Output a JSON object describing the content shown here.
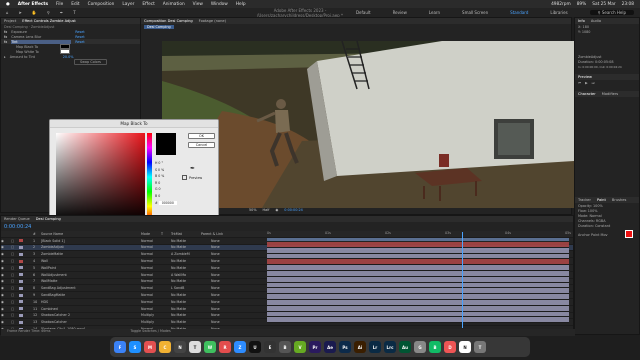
{
  "mac_menu": {
    "app": "After Effects",
    "items": [
      "File",
      "Edit",
      "Composition",
      "Layer",
      "Effect",
      "Animation",
      "View",
      "Window",
      "Help"
    ],
    "status": [
      "4982rpm",
      "89%",
      "Sat 25 Mar",
      "23:08"
    ]
  },
  "title": "Adobe After Effects 2023 - /Users/zacharychildress/Desktop/Proj.aep *",
  "toolbar": {
    "workspaces": [
      "Default",
      "Review",
      "Learn",
      "Small Screen",
      "Standard",
      "Libraries"
    ],
    "active": "Standard",
    "search": "Search Help"
  },
  "effect_controls": {
    "tabs": [
      "Project",
      "Effect Controls Zombie Adjust"
    ],
    "header": "Desi Comping · ZombieAdjust",
    "rows": [
      {
        "name": "Exposure",
        "value": "Reset"
      },
      {
        "name": "Camera Lens Blur",
        "value": "Reset"
      },
      {
        "name": "Tint",
        "value": "Reset"
      },
      {
        "name": "Map Black To",
        "value": ""
      },
      {
        "name": "Map White To",
        "value": ""
      },
      {
        "name": "Amount to Tint",
        "value": "20.0%"
      }
    ],
    "swap_button": "Swap Colors"
  },
  "comp": {
    "tabs": [
      "Composition Desi Comping",
      "Footage (none)"
    ],
    "breadcrumb": "Desi Comping",
    "zoom": "50%",
    "quality": "Half",
    "timecode": "0:00:00:24"
  },
  "dialog": {
    "title": "Map Black To",
    "ok": "OK",
    "cancel": "Cancel",
    "preview": "Preview",
    "fields": [
      {
        "label": "H",
        "value": "0 °"
      },
      {
        "label": "S",
        "value": "0 %"
      },
      {
        "label": "B",
        "value": "0 %"
      },
      {
        "label": "R",
        "value": "0"
      },
      {
        "label": "G",
        "value": "0"
      },
      {
        "label": "B",
        "value": "0"
      }
    ],
    "hex_label": "#",
    "hex": "000000"
  },
  "right_panels": {
    "info": {
      "tabs": [
        "Info",
        "Audio"
      ],
      "x": "X: 180",
      "y": "Y: 1080"
    },
    "name": "ZombieAdjust",
    "duration": "Duration: 0:00:05:08",
    "in_out": "In: 0:00:00:00, Out: 0:00:04:24",
    "preview": "Preview",
    "character_tabs": [
      "Character",
      "Modifiers"
    ],
    "tracker_tabs": [
      "Tracker",
      "Paint",
      "Brushes"
    ],
    "paint": {
      "opacity": "Opacity: 100%",
      "flow": "Flow: 100%",
      "mode": "Mode: Normal",
      "channels": "Channels: RGBA",
      "duration": "Duration: Constant"
    },
    "anchor": "Anchor Point Mov"
  },
  "timeline": {
    "tab": "Desi Comping",
    "render_q": "Render Queue",
    "timecode": "0:00:00:24",
    "columns": [
      "#",
      "Source Name",
      "Mode",
      "T",
      "TrkMat",
      "",
      "Parent & Link"
    ],
    "rulers": [
      "0s",
      "01s",
      "02s",
      "03s",
      "04s",
      "05s"
    ],
    "layers": [
      {
        "n": "1",
        "name": "[Black Solid 1]",
        "mode": "Normal",
        "trk": "No Matte",
        "parent": "None",
        "color": "#b04848"
      },
      {
        "n": "2",
        "name": "ZombieAdjust",
        "mode": "Normal",
        "trk": "No Matte",
        "parent": "None",
        "color": "#9a9ab8"
      },
      {
        "n": "3",
        "name": "ZombieMatte",
        "mode": "Normal",
        "trk": "A ZombieM",
        "parent": "None",
        "color": "#9a9ab8"
      },
      {
        "n": "4",
        "name": "Wall",
        "mode": "Normal",
        "trk": "No Matte",
        "parent": "None",
        "color": "#b04848"
      },
      {
        "n": "5",
        "name": "WallPaint",
        "mode": "Normal",
        "trk": "No Matte",
        "parent": "None",
        "color": "#9a9ab8"
      },
      {
        "n": "6",
        "name": "WallAdjustment",
        "mode": "Normal",
        "trk": "A WallMa",
        "parent": "None",
        "color": "#9a9ab8"
      },
      {
        "n": "7",
        "name": "WallMatte",
        "mode": "Normal",
        "trk": "No Matte",
        "parent": "None",
        "color": "#9a9ab8"
      },
      {
        "n": "8",
        "name": "SandBag Adjustment",
        "mode": "Normal",
        "trk": "L SandB",
        "parent": "None",
        "color": "#9a9ab8"
      },
      {
        "n": "9",
        "name": "SandBagMatte",
        "mode": "Normal",
        "trk": "No Matte",
        "parent": "None",
        "color": "#9a9ab8"
      },
      {
        "n": "10",
        "name": "HDS",
        "mode": "Normal",
        "trk": "No Matte",
        "parent": "None",
        "color": "#9a9ab8"
      },
      {
        "n": "11",
        "name": "Combined",
        "mode": "Normal",
        "trk": "No Matte",
        "parent": "None",
        "color": "#9a9ab8"
      },
      {
        "n": "12",
        "name": "ShadowCatcher 2",
        "mode": "Multiply",
        "trk": "No Matte",
        "parent": "None",
        "color": "#9a9ab8"
      },
      {
        "n": "13",
        "name": "ShadowCatcher",
        "mode": "Multiply",
        "trk": "No Matte",
        "parent": "None",
        "color": "#9a9ab8"
      },
      {
        "n": "14",
        "name": "[Footage_Clip1_1080.mov]",
        "mode": "Normal",
        "trk": "No Matte",
        "parent": "None",
        "color": "#9a9ab8"
      }
    ],
    "footer_left": "Frame Render Time: 69ms",
    "footer_mid": "Toggle Switches / Modes"
  },
  "dock": {
    "apps": [
      {
        "label": "F",
        "color": "#3b82f6"
      },
      {
        "label": "S",
        "color": "#1e90ff"
      },
      {
        "label": "M",
        "color": "#e35050"
      },
      {
        "label": "C",
        "color": "#f2b233"
      },
      {
        "label": "N",
        "color": "#444"
      },
      {
        "label": "T",
        "color": "#ddd"
      },
      {
        "label": "W",
        "color": "#3fbf5f"
      },
      {
        "label": "R",
        "color": "#e34d4d"
      },
      {
        "label": "Z",
        "color": "#2d8cff"
      },
      {
        "label": "U",
        "color": "#111"
      },
      {
        "label": "E",
        "color": "#333"
      },
      {
        "label": "B",
        "color": "#555"
      },
      {
        "label": "V",
        "color": "#6a2"
      },
      {
        "label": "Pr",
        "color": "#2a1a5e"
      },
      {
        "label": "Ae",
        "color": "#1a1a4e"
      },
      {
        "label": "Ps",
        "color": "#0c2a4a"
      },
      {
        "label": "Ai",
        "color": "#3a1e00"
      },
      {
        "label": "Lr",
        "color": "#0a2a44"
      },
      {
        "label": "Lrc",
        "color": "#0a2a44"
      },
      {
        "label": "Au",
        "color": "#053"
      },
      {
        "label": "G",
        "color": "#888"
      },
      {
        "label": "B",
        "color": "#1b6"
      },
      {
        "label": "D",
        "color": "#e55"
      },
      {
        "label": "N",
        "color": "#fff"
      },
      {
        "label": "T",
        "color": "#777"
      }
    ]
  }
}
